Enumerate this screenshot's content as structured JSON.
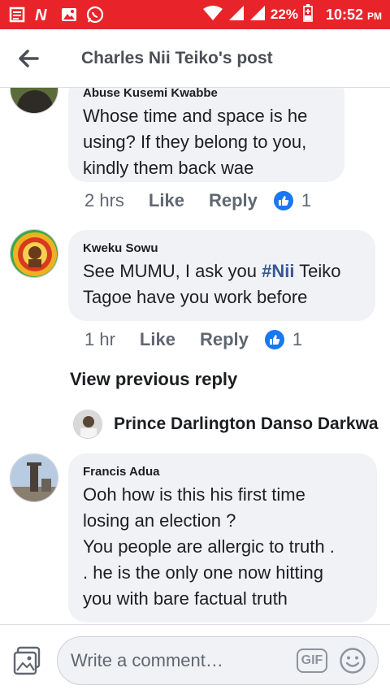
{
  "status_bar": {
    "battery": "22%",
    "time": "10:52",
    "ampm": "PM"
  },
  "header": {
    "title": "Charles Nii Teiko's post"
  },
  "comments": [
    {
      "name": "Abuse Kusemi Kwabbe",
      "text": "Whose time and space is he\nusing? If they belong to you,\nkindly them back wae",
      "time": "2 hrs",
      "like_label": "Like",
      "reply_label": "Reply",
      "reaction_count": "1"
    },
    {
      "name": "Kweku Sowu",
      "text_prefix": "See MUMU, I ask you ",
      "hashtag": "#Nii",
      "text_suffix": " Teiko\nTagoe have you work before",
      "time": "1 hr",
      "like_label": "Like",
      "reply_label": "Reply",
      "reaction_count": "1"
    },
    {
      "name": "Francis Adua",
      "text": "Ooh how is this his first time\nlosing an election ?\nYou people are allergic to truth .\n. he is the only one now hitting\nyou with bare factual truth"
    }
  ],
  "view_previous_reply": "View previous reply",
  "reply_preview": {
    "name": "Prince Darlington Danso Darkwa"
  },
  "composer": {
    "placeholder": "Write a comment…",
    "gif_label": "GIF"
  },
  "colors": {
    "status_bar": "#e8242a",
    "bubble": "#f0f2f5",
    "hashtag": "#385898",
    "like_badge": "#1877f2"
  }
}
